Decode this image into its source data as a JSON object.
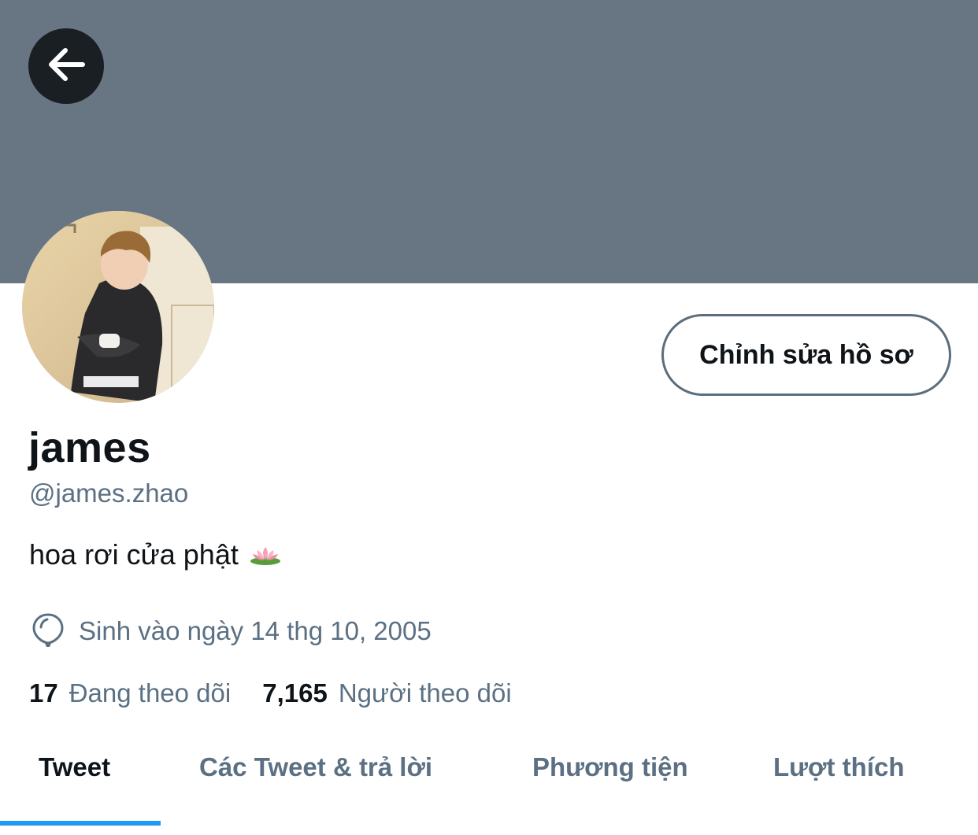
{
  "header": {
    "banner_color": "#687684",
    "back_icon": "arrow-left-icon"
  },
  "profile": {
    "display_name": "james",
    "handle": "@james.zhao",
    "bio": "hoa rơi cửa phật",
    "bio_emoji": "lotus-icon",
    "birth_icon": "balloon-icon",
    "birth_text": "Sinh vào ngày 14 thg 10, 2005",
    "edit_button_label": "Chỉnh sửa hồ sơ"
  },
  "stats": {
    "following_count": "17",
    "following_label": "Đang theo dõi",
    "followers_count": "7,165",
    "followers_label": "Người theo dõi"
  },
  "tabs": [
    {
      "label": "Tweet",
      "active": true
    },
    {
      "label": "Các Tweet & trả lời",
      "active": false
    },
    {
      "label": "Phương tiện",
      "active": false
    },
    {
      "label": "Lượt thích",
      "active": false
    }
  ],
  "colors": {
    "accent": "#1d9bf0",
    "secondary_text": "#5b7083",
    "primary_text": "#0f1419"
  }
}
